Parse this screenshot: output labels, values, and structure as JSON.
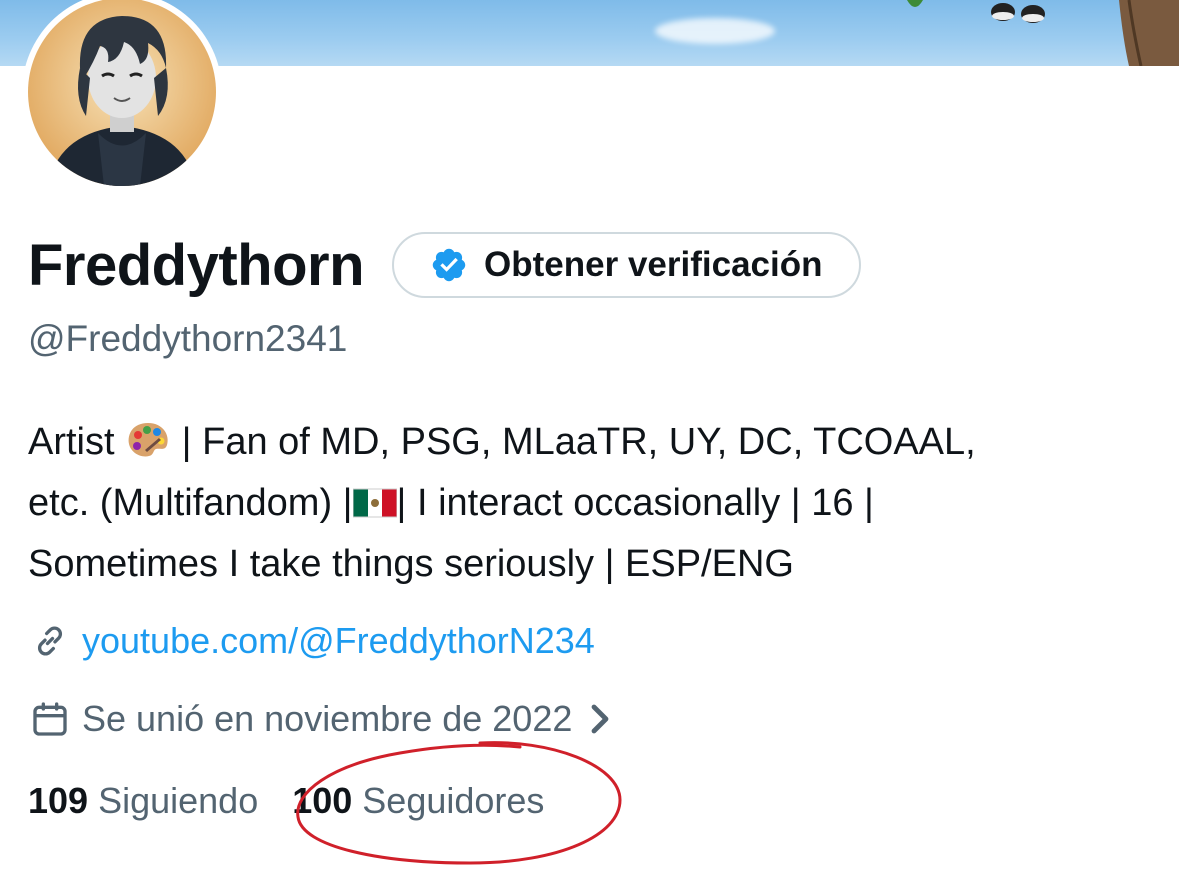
{
  "profile": {
    "display_name": "Freddythorn",
    "handle": "@Freddythorn2341",
    "verify_button_label": "Obtener verificación",
    "bio": {
      "line1_prefix": "Artist ",
      "line1_suffix": " | Fan of MD, PSG, MLaaTR, UY, DC, TCOAAL,",
      "line2_prefix": "etc. (Multifandom) |",
      "line2_suffix": "| I interact occasionally | 16 |",
      "line3": "Sometimes I take things seriously | ESP/ENG"
    },
    "link": "youtube.com/@FreddythorN234",
    "joined": "Se unió en noviembre de 2022"
  },
  "stats": {
    "following_count": "109",
    "following_label": "Siguiendo",
    "followers_count": "100",
    "followers_label": "Seguidores"
  },
  "icons": {
    "verify": "verified-badge-icon",
    "link": "link-icon",
    "calendar": "calendar-icon",
    "chevron": "chevron-right-icon",
    "palette": "artist-palette-emoji",
    "flag": "mexico-flag-emoji"
  },
  "colors": {
    "accent": "#1d9bf0",
    "secondary_text": "#536471",
    "primary_text": "#0f1419",
    "annotation": "#d0202a"
  }
}
